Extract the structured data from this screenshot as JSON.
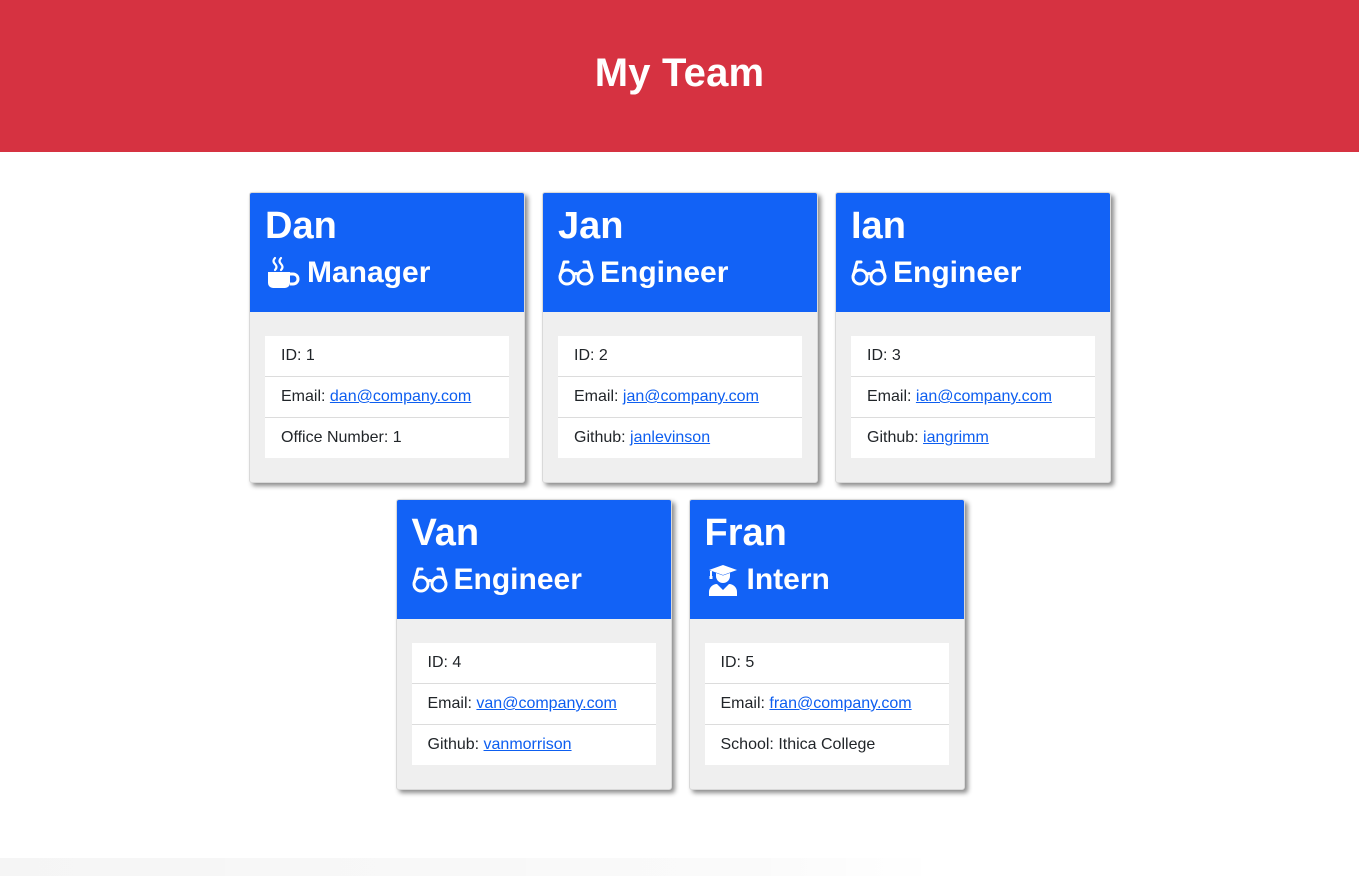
{
  "header": {
    "title": "My Team"
  },
  "colors": {
    "header": "#d63241",
    "card_head": "#1262f6",
    "link": "#0d5ef0"
  },
  "team": [
    {
      "name": "Dan",
      "role": "Manager",
      "icon": "coffee-mug-icon",
      "id_label": "ID: ",
      "id": "1",
      "email_label": "Email: ",
      "email": "dan@company.com",
      "extra_label": "Office Number: ",
      "extra": "1",
      "extra_is_link": false
    },
    {
      "name": "Jan",
      "role": "Engineer",
      "icon": "glasses-icon",
      "id_label": "ID: ",
      "id": "2",
      "email_label": "Email: ",
      "email": "jan@company.com",
      "extra_label": "Github: ",
      "extra": "janlevinson",
      "extra_is_link": true
    },
    {
      "name": "Ian",
      "role": "Engineer",
      "icon": "glasses-icon",
      "id_label": "ID: ",
      "id": "3",
      "email_label": "Email: ",
      "email": "ian@company.com",
      "extra_label": "Github: ",
      "extra": "iangrimm",
      "extra_is_link": true
    },
    {
      "name": "Van",
      "role": "Engineer",
      "icon": "glasses-icon",
      "id_label": "ID: ",
      "id": "4",
      "email_label": "Email: ",
      "email": "van@company.com",
      "extra_label": "Github: ",
      "extra": "vanmorrison",
      "extra_is_link": true
    },
    {
      "name": "Fran",
      "role": "Intern",
      "icon": "graduate-icon",
      "id_label": "ID: ",
      "id": "5",
      "email_label": "Email: ",
      "email": "fran@company.com",
      "extra_label": "School: ",
      "extra": "Ithica College",
      "extra_is_link": false
    }
  ]
}
